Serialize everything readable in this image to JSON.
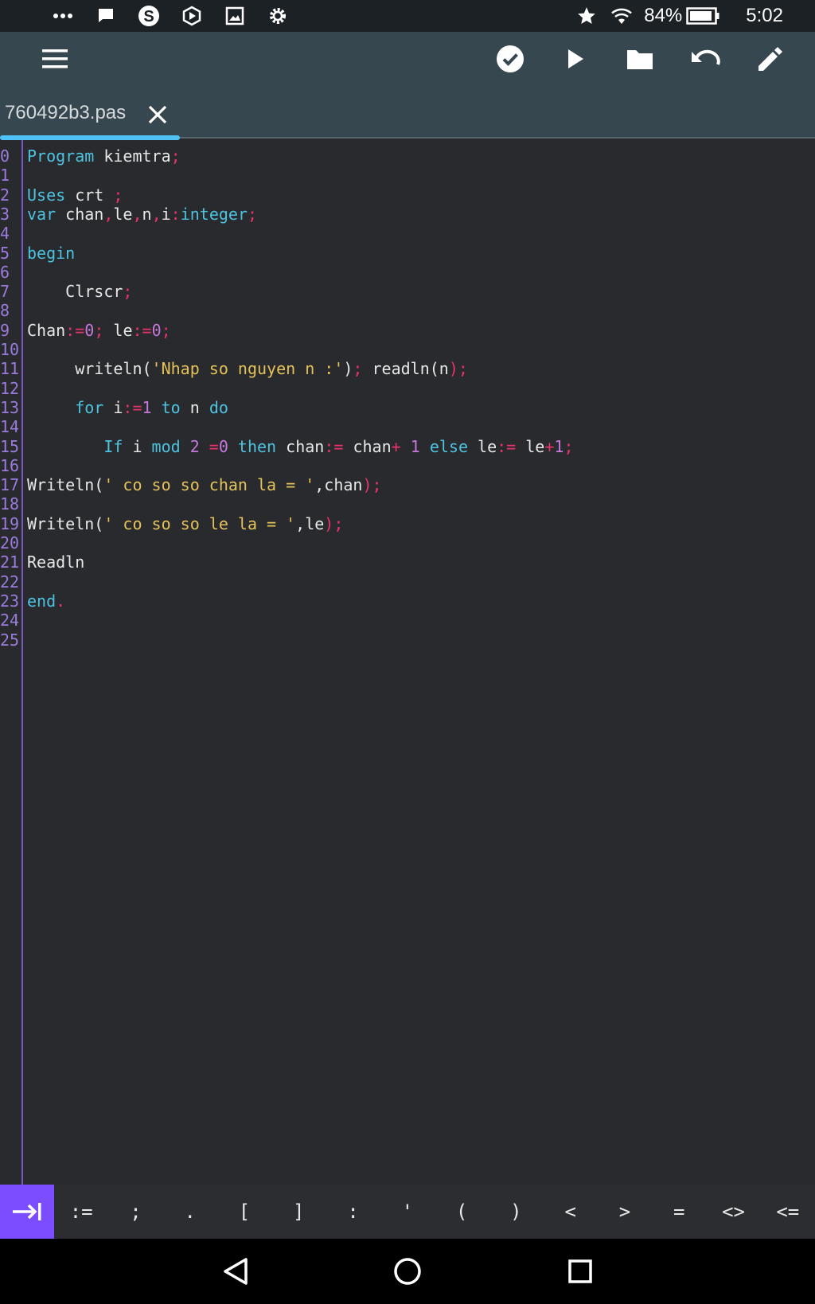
{
  "status_bar": {
    "battery": "84%",
    "time": "5:02",
    "left_icons": [
      "more-icon",
      "chat-icon",
      "skype-icon",
      "hexagon-icon",
      "image-icon",
      "settings-icon"
    ],
    "right_icons": [
      "star-icon",
      "wifi-icon",
      "battery-icon"
    ]
  },
  "toolbar": {
    "buttons": [
      "menu-icon",
      "check-icon",
      "play-icon",
      "folder-icon",
      "undo-icon",
      "edit-icon"
    ]
  },
  "tab": {
    "filename": "760492b3.pas"
  },
  "editor": {
    "line_numbers": [
      "0",
      "1",
      "2",
      "3",
      "4",
      "5",
      "6",
      "7",
      "8",
      "9",
      "10",
      "11",
      "12",
      "13",
      "14",
      "15",
      "16",
      "17",
      "18",
      "19",
      "20",
      "21",
      "22",
      "23",
      "24",
      "25"
    ],
    "lines": [
      [
        [
          "kw",
          "Program"
        ],
        [
          "pl",
          " kiemtra"
        ],
        [
          "op",
          ";"
        ]
      ],
      [],
      [
        [
          "kw",
          "Uses"
        ],
        [
          "pl",
          " crt "
        ],
        [
          "op",
          ";"
        ]
      ],
      [
        [
          "kw",
          "var"
        ],
        [
          "pl",
          " chan"
        ],
        [
          "op",
          ","
        ],
        [
          "pl",
          "le"
        ],
        [
          "op",
          ","
        ],
        [
          "pl",
          "n"
        ],
        [
          "op",
          ","
        ],
        [
          "pl",
          "i"
        ],
        [
          "op",
          ":"
        ],
        [
          "kw",
          "integer"
        ],
        [
          "op",
          ";"
        ]
      ],
      [],
      [
        [
          "kw",
          "begin"
        ]
      ],
      [],
      [
        [
          "pl",
          "    Clrscr"
        ],
        [
          "op",
          ";"
        ]
      ],
      [],
      [
        [
          "pl",
          "Chan"
        ],
        [
          "op",
          ":="
        ],
        [
          "num",
          "0"
        ],
        [
          "op",
          ";"
        ],
        [
          "pl",
          " le"
        ],
        [
          "op",
          ":="
        ],
        [
          "num",
          "0"
        ],
        [
          "op",
          ";"
        ]
      ],
      [],
      [
        [
          "pl",
          "     writeln("
        ],
        [
          "str",
          "'Nhap so nguyen n :'"
        ],
        [
          "pl",
          ")"
        ],
        [
          "op",
          ";"
        ],
        [
          "pl",
          " readln("
        ],
        [
          "pl",
          "n"
        ],
        [
          "op",
          ")"
        ],
        [
          "op",
          ";"
        ]
      ],
      [],
      [
        [
          "kw",
          "     for"
        ],
        [
          "pl",
          " i"
        ],
        [
          "op",
          ":="
        ],
        [
          "num",
          "1"
        ],
        [
          "kw",
          " to"
        ],
        [
          "pl",
          " n "
        ],
        [
          "kw",
          "do"
        ]
      ],
      [],
      [
        [
          "kw",
          "        If"
        ],
        [
          "pl",
          " i "
        ],
        [
          "kw",
          "mod"
        ],
        [
          "num",
          " 2 "
        ],
        [
          "op",
          "="
        ],
        [
          "num",
          "0"
        ],
        [
          "kw",
          " then"
        ],
        [
          "pl",
          " chan"
        ],
        [
          "op",
          ":="
        ],
        [
          "pl",
          " chan"
        ],
        [
          "op",
          "+"
        ],
        [
          "num",
          " 1"
        ],
        [
          "kw",
          " else"
        ],
        [
          "pl",
          " le"
        ],
        [
          "op",
          ":="
        ],
        [
          "pl",
          " le"
        ],
        [
          "op",
          "+"
        ],
        [
          "num",
          "1"
        ],
        [
          "op",
          ";"
        ]
      ],
      [],
      [
        [
          "pl",
          "Writeln("
        ],
        [
          "str",
          "' co so so chan la = '"
        ],
        [
          "pl",
          ",chan"
        ],
        [
          "op",
          ")"
        ],
        [
          "op",
          ";"
        ]
      ],
      [],
      [
        [
          "pl",
          "Writeln("
        ],
        [
          "str",
          "' co so so le la = '"
        ],
        [
          "pl",
          ",le"
        ],
        [
          "op",
          ")"
        ],
        [
          "op",
          ";"
        ]
      ],
      [],
      [
        [
          "pl",
          "Readln"
        ]
      ],
      [],
      [
        [
          "kw",
          "end"
        ],
        [
          "op",
          "."
        ]
      ],
      [],
      []
    ]
  },
  "symbol_bar": {
    "keys": [
      ":=",
      ";",
      ".",
      "[",
      "]",
      ":",
      "'",
      "(",
      ")",
      "<",
      ">",
      "=",
      "<>",
      "<="
    ]
  }
}
